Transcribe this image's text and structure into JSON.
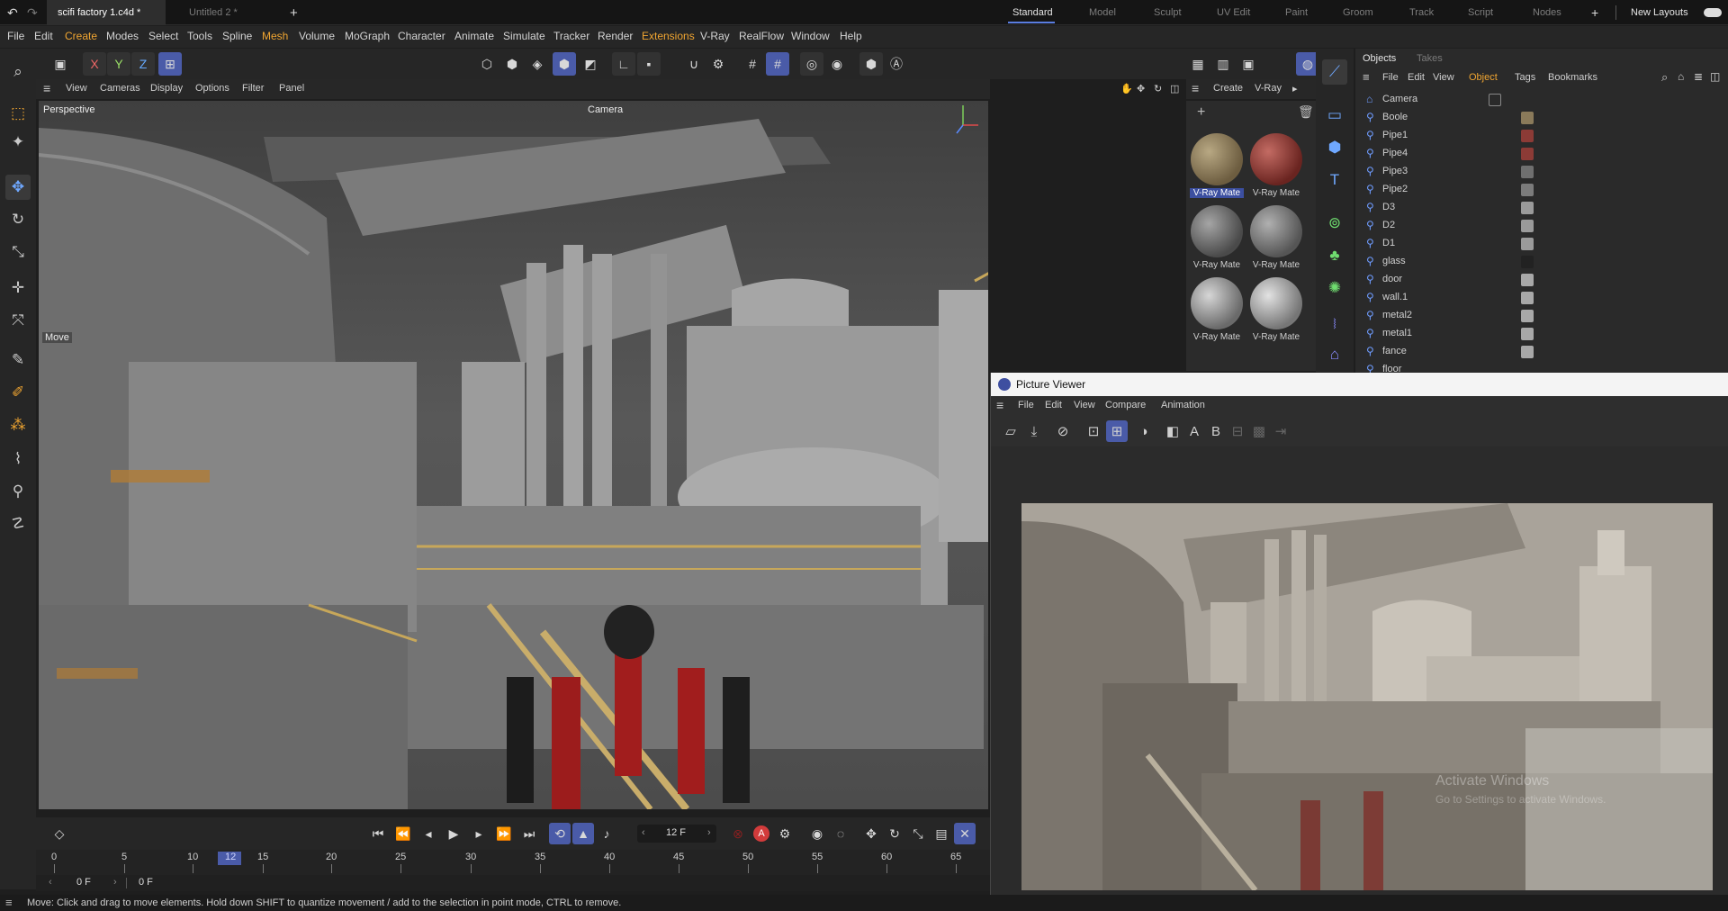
{
  "tabs": {
    "doc_active": "scifi factory 1.c4d *",
    "doc_close": "×",
    "doc_inactive": "Untitled 2 *",
    "add": "+"
  },
  "layouts": {
    "items": [
      "Standard",
      "Model",
      "Sculpt",
      "UV Edit",
      "Paint",
      "Groom",
      "Track",
      "Script",
      "Nodes"
    ],
    "active": "Standard",
    "add": "+",
    "new_layouts": "New Layouts"
  },
  "menubar": {
    "items": [
      "File",
      "Edit",
      "Create",
      "Modes",
      "Select",
      "Tools",
      "Spline",
      "Mesh",
      "Volume",
      "MoGraph",
      "Character",
      "Animate",
      "Simulate",
      "Tracker",
      "Render",
      "Extensions",
      "V-Ray",
      "RealFlow",
      "Window",
      "Help"
    ]
  },
  "toolbar": {
    "axis_x": "X",
    "axis_y": "Y",
    "axis_z": "Z"
  },
  "viewport": {
    "menu": [
      "View",
      "Cameras",
      "Display",
      "Options",
      "Filter",
      "Panel"
    ],
    "label": "Perspective",
    "camera_label": "Camera",
    "hud_move": "Move"
  },
  "materials": {
    "menu": [
      "Create",
      "V-Ray"
    ],
    "items": [
      {
        "name": "V-Ray Mate",
        "color": "#8a7a5a",
        "selected": true
      },
      {
        "name": "V-Ray Mate",
        "color": "#8c3b36",
        "selected": false
      },
      {
        "name": "V-Ray Mate",
        "color": "#6f6f6f",
        "selected": false
      },
      {
        "name": "V-Ray Mate",
        "color": "#7b7b7b",
        "selected": false
      },
      {
        "name": "V-Ray Mate",
        "color": "#9a9a9a",
        "selected": false
      },
      {
        "name": "V-Ray Mate",
        "color": "#a8a8a8",
        "selected": false
      }
    ]
  },
  "objects": {
    "tabs": [
      "Objects",
      "Takes"
    ],
    "menu": [
      "File",
      "Edit",
      "View",
      "Object",
      "Tags",
      "Bookmarks"
    ],
    "active_menu": "Object",
    "rows": [
      "Camera",
      "Boole",
      "Pipe1",
      "Pipe4",
      "Pipe3",
      "Pipe2",
      "D3",
      "D2",
      "D1",
      "glass",
      "door",
      "wall.1",
      "metal2",
      "metal1",
      "fance",
      "floor"
    ]
  },
  "picture_viewer": {
    "title": "Picture Viewer",
    "menu": [
      "File",
      "Edit",
      "View",
      "Compare",
      "Animation"
    ],
    "label_a": "A",
    "label_b": "B",
    "watermark_1": "Activate Windows",
    "watermark_2": "Go to Settings to activate Windows."
  },
  "timeline": {
    "current_frame": "12 F",
    "ticks": [
      "0",
      "5",
      "10",
      "15",
      "20",
      "25",
      "30",
      "35",
      "40",
      "45",
      "50",
      "55",
      "60",
      "65"
    ],
    "playhead_label": "12",
    "start_frame": "0 F",
    "end_frame": "0 F"
  },
  "status": {
    "text": "Move: Click and drag to move elements. Hold down SHIFT to quantize movement / add to the selection in point mode, CTRL to remove."
  },
  "colors": {
    "accent_blue": "#4a5ba8",
    "menu_highlight": "#f0a531",
    "record_red": "#d23b3b"
  }
}
